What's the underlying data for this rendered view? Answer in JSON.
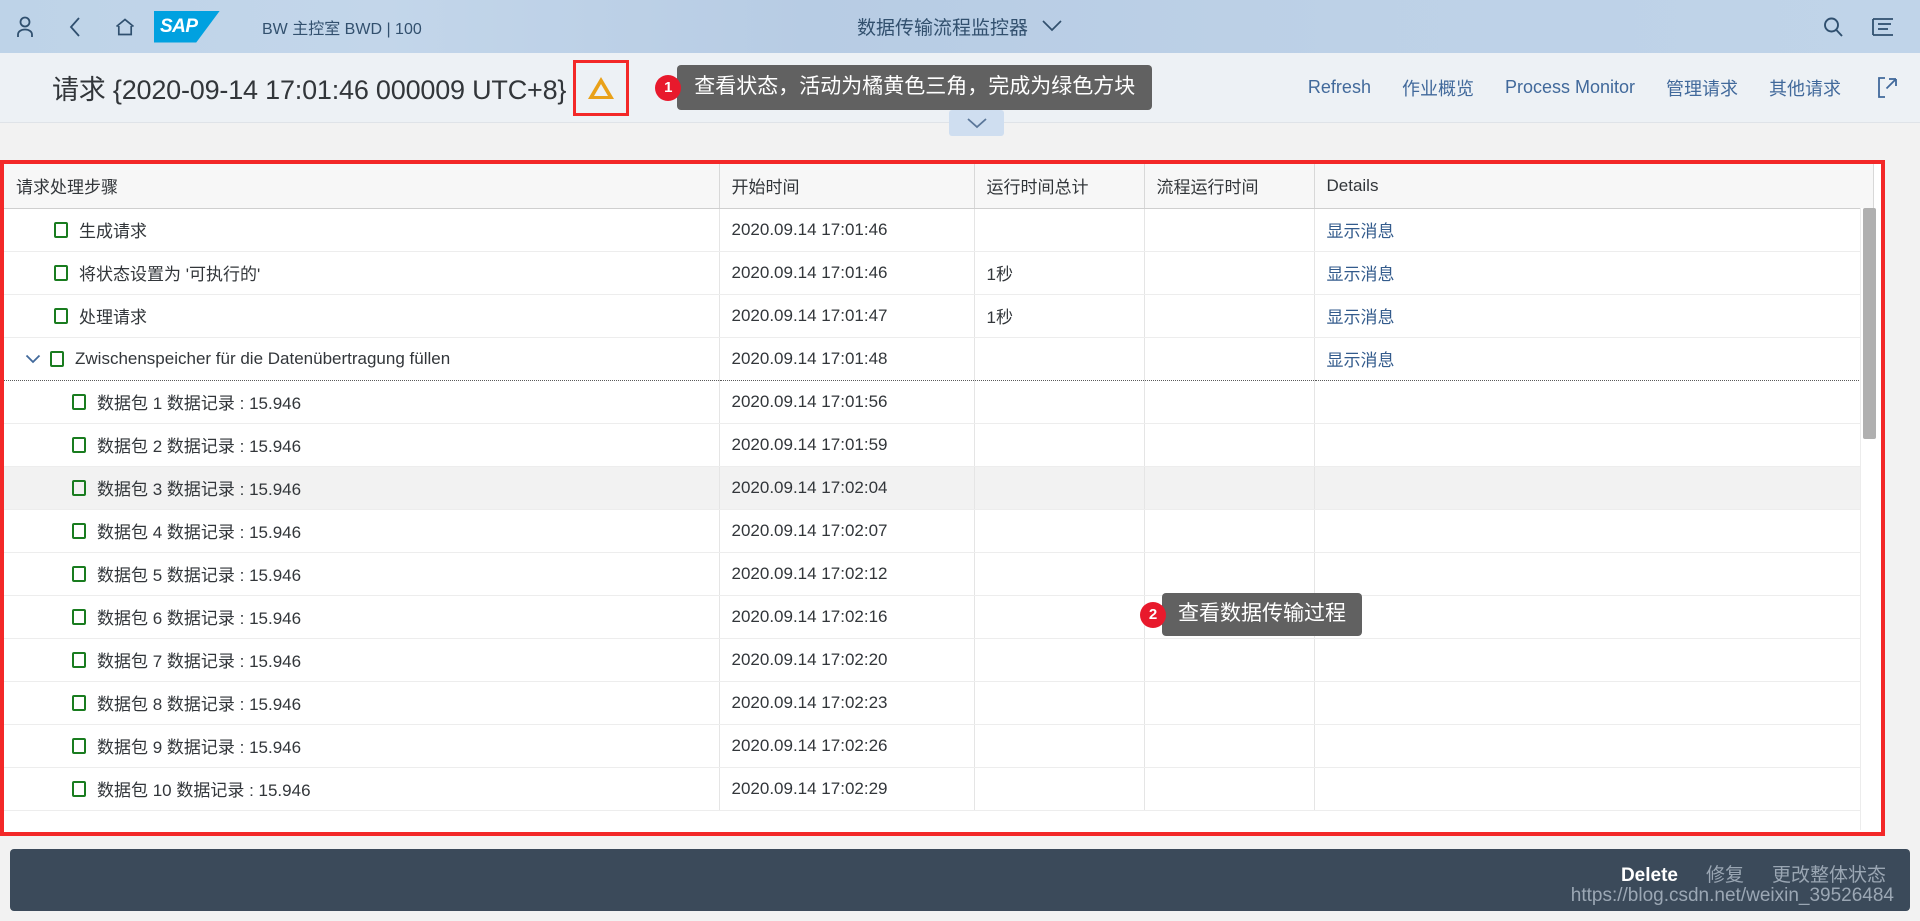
{
  "shell": {
    "icons": {
      "user": "user-icon",
      "back": "back-icon",
      "home": "home-icon",
      "search": "search-icon",
      "menu": "list-menu-icon"
    },
    "logo_text": "SAP",
    "system_info": "BW 主控室 BWD | 100",
    "app_title": "数据传输流程监控器"
  },
  "toolbar": {
    "object_title": "请求 {2020-09-14 17:01:46 000009 UTC+8}",
    "status_icon": "warning-triangle-icon",
    "callout1": {
      "number": "1",
      "text": "查看状态，活动为橘黄色三角，完成为绿色方块"
    },
    "actions": [
      {
        "label": "Refresh",
        "name": "refresh-button"
      },
      {
        "label": "作业概览",
        "name": "job-overview-button"
      },
      {
        "label": "Process Monitor",
        "name": "process-monitor-button"
      },
      {
        "label": "管理请求",
        "name": "manage-request-button"
      },
      {
        "label": "其他请求",
        "name": "other-request-button"
      }
    ],
    "open_external_icon": "open-in-new-icon"
  },
  "table": {
    "columns": [
      "请求处理步骤",
      "开始时间",
      "运行时间总计",
      "流程运行时间",
      "Details"
    ],
    "rows": [
      {
        "step": "生成请求",
        "indent": 1,
        "status": "green-square",
        "chevron": false,
        "start": "2020.09.14 17:01:46",
        "total_runtime": "",
        "process_runtime": "",
        "details": "显示消息"
      },
      {
        "step": "将状态设置为 '可执行的'",
        "indent": 1,
        "status": "green-square",
        "chevron": false,
        "start": "2020.09.14 17:01:46",
        "total_runtime": "1秒",
        "process_runtime": "",
        "details": "显示消息"
      },
      {
        "step": "处理请求",
        "indent": 1,
        "status": "green-square",
        "chevron": false,
        "start": "2020.09.14 17:01:47",
        "total_runtime": "1秒",
        "process_runtime": "",
        "details": "显示消息"
      },
      {
        "step": "Zwischenspeicher für die Datenübertragung füllen",
        "indent": 0,
        "status": "green-square",
        "chevron": true,
        "start": "2020.09.14 17:01:48",
        "total_runtime": "",
        "process_runtime": "",
        "details": "显示消息",
        "selected": true
      },
      {
        "step": "数据包 1 数据记录 : 15.946",
        "indent": 2,
        "status": "green-square",
        "chevron": false,
        "start": "2020.09.14 17:01:56",
        "total_runtime": "",
        "process_runtime": "",
        "details": ""
      },
      {
        "step": "数据包 2 数据记录 : 15.946",
        "indent": 2,
        "status": "green-square",
        "chevron": false,
        "start": "2020.09.14 17:01:59",
        "total_runtime": "",
        "process_runtime": "",
        "details": ""
      },
      {
        "step": "数据包 3 数据记录 : 15.946",
        "indent": 2,
        "status": "green-square",
        "chevron": false,
        "start": "2020.09.14 17:02:04",
        "total_runtime": "",
        "process_runtime": "",
        "details": "",
        "alt": true
      },
      {
        "step": "数据包 4 数据记录 : 15.946",
        "indent": 2,
        "status": "green-square",
        "chevron": false,
        "start": "2020.09.14 17:02:07",
        "total_runtime": "",
        "process_runtime": "",
        "details": ""
      },
      {
        "step": "数据包 5 数据记录 : 15.946",
        "indent": 2,
        "status": "green-square",
        "chevron": false,
        "start": "2020.09.14 17:02:12",
        "total_runtime": "",
        "process_runtime": "",
        "details": ""
      },
      {
        "step": "数据包 6 数据记录 : 15.946",
        "indent": 2,
        "status": "green-square",
        "chevron": false,
        "start": "2020.09.14 17:02:16",
        "total_runtime": "",
        "process_runtime": "",
        "details": ""
      },
      {
        "step": "数据包 7 数据记录 : 15.946",
        "indent": 2,
        "status": "green-square",
        "chevron": false,
        "start": "2020.09.14 17:02:20",
        "total_runtime": "",
        "process_runtime": "",
        "details": ""
      },
      {
        "step": "数据包 8 数据记录 : 15.946",
        "indent": 2,
        "status": "green-square",
        "chevron": false,
        "start": "2020.09.14 17:02:23",
        "total_runtime": "",
        "process_runtime": "",
        "details": ""
      },
      {
        "step": "数据包 9 数据记录 : 15.946",
        "indent": 2,
        "status": "green-square",
        "chevron": false,
        "start": "2020.09.14 17:02:26",
        "total_runtime": "",
        "process_runtime": "",
        "details": ""
      },
      {
        "step": "数据包 10 数据记录 : 15.946",
        "indent": 2,
        "status": "green-square",
        "chevron": false,
        "start": "2020.09.14 17:02:29",
        "total_runtime": "",
        "process_runtime": "",
        "details": ""
      }
    ]
  },
  "callout2": {
    "number": "2",
    "text": "查看数据传输过程"
  },
  "footer": {
    "delete_label": "Delete",
    "repair_label": "修复",
    "change_status_label": "更改整体状态",
    "watermark": "https://blog.csdn.net/weixin_39526484"
  },
  "colors": {
    "accent_red": "#f32828",
    "sap_blue": "#00a1e0",
    "link_blue": "#41699b",
    "status_green": "#197c1f",
    "status_orange": "#e9a119",
    "footer_bg": "#3b4a5a"
  }
}
